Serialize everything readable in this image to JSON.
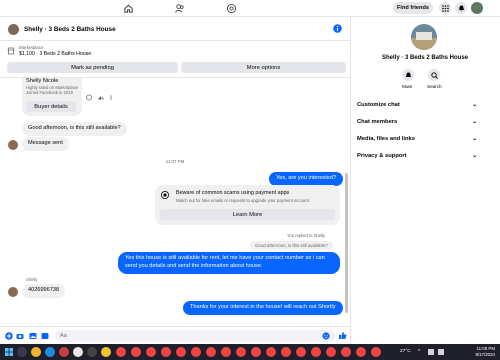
{
  "topbar": {
    "find_friends": "Find friends"
  },
  "chat": {
    "title": "Shelly · 3 Beds 2 Baths House",
    "marketplace_label": "Marketplace",
    "listing": "$1,100 · 3 Beds 2 Baths House",
    "mark_pending": "Mark as pending",
    "more_options": "More options"
  },
  "seller_card": {
    "name": "Shelly Nicole",
    "line1": "Highly rated on Marketplace",
    "line2": "Joined Facebook in 2019",
    "buyer_details": "Buyer details"
  },
  "messages": {
    "m1": "Good afternoon, is this still available?",
    "m2": "Message sent",
    "time": "11:07 PM",
    "m3": "Yes, are you interested?",
    "scam_title": "Beware of common scams using payment apps",
    "scam_body": "Watch out for fake emails or requests to upgrade your payment account.",
    "learn_more": "Learn More",
    "replied_to": "You replied to Shelly",
    "quoted": "Good afternoon, is this still available?",
    "m4": "Yes this house is still available for rent, let me have your contact number so i can send you details and send the information about house.",
    "sender_label": "Shelly",
    "m5": "4026996738",
    "m6": "Thanks for your interest in the house! will reach out Shortly",
    "composer_text": "Aa"
  },
  "panel": {
    "name": "Shelly · 3 Beds 2 Baths House",
    "mute": "Mute",
    "search": "Search",
    "rows": [
      "Customize chat",
      "Chat members",
      "Media, files and links",
      "Privacy & support"
    ]
  },
  "taskbar": {
    "temp": "27°C",
    "time": "11:08 PM",
    "date": "9/17/2024"
  },
  "colors": {
    "accent": "#0866ff",
    "bubble_in": "#f0f0f0",
    "taskbar": "#1f1f2b"
  }
}
